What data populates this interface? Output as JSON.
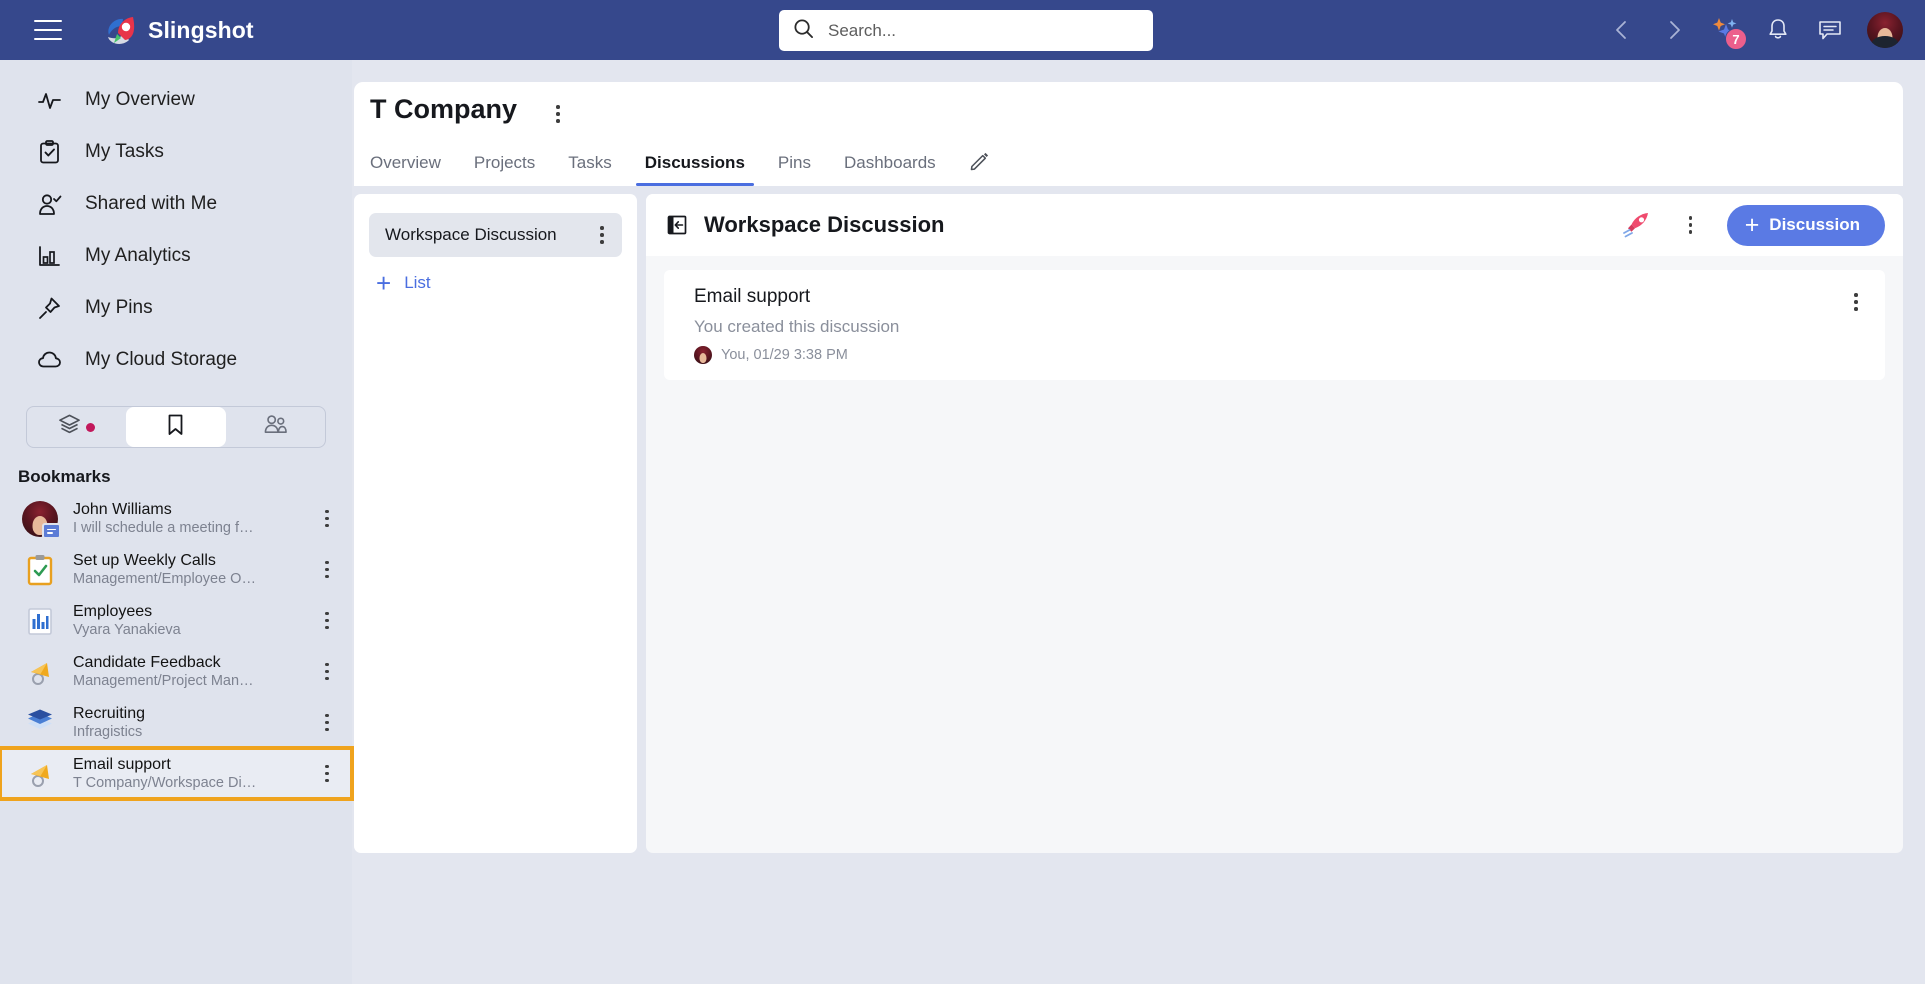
{
  "app": {
    "brand_name": "Slingshot",
    "colors": {
      "header_navy": "#36488c",
      "sidebar_bg": "#dfe3ed",
      "accent_blue": "#4a6ee0",
      "button_blue": "#5a7ae4",
      "highlight_orange": "#efa31d",
      "badge_pink": "#ec5f8c",
      "dot_magenta": "#c2185b"
    }
  },
  "topbar": {
    "menu_icon": "hamburger-icon",
    "logo_icon": "slingshot-logo-icon",
    "search": {
      "placeholder": "Search...",
      "value": "",
      "icon": "search-icon"
    },
    "back_icon": "chevron-left-icon",
    "forward_icon": "chevron-right-icon",
    "sparkle_icon": "sparkles-icon",
    "sparkle_badge": "7",
    "bell_icon": "bell-icon",
    "chat_icon": "chat-icon",
    "avatar": "user-avatar"
  },
  "sidebar": {
    "nav_items": [
      {
        "label": "My Overview",
        "icon": "activity-pulse-icon"
      },
      {
        "label": "My Tasks",
        "icon": "clipboard-check-icon"
      },
      {
        "label": "Shared with Me",
        "icon": "person-check-icon"
      },
      {
        "label": "My Analytics",
        "icon": "bar-chart-icon"
      },
      {
        "label": "My Pins",
        "icon": "pin-icon"
      },
      {
        "label": "My Cloud Storage",
        "icon": "cloud-icon"
      }
    ],
    "tab_switch": [
      {
        "icon": "layers-icon",
        "active": false,
        "has_dot": true
      },
      {
        "icon": "bookmark-icon",
        "active": true,
        "has_dot": false
      },
      {
        "icon": "people-icon",
        "active": false,
        "has_dot": false
      }
    ],
    "bookmarks_title": "Bookmarks",
    "bookmarks": [
      {
        "name": "John Williams",
        "sub": "I will schedule a meeting f…",
        "icon": "avatar-chat-icon",
        "selected": false
      },
      {
        "name": "Set up Weekly Calls",
        "sub": "Management/Employee O…",
        "icon": "clipboard-task-icon",
        "selected": false
      },
      {
        "name": "Employees",
        "sub": "Vyara Yanakieva",
        "icon": "chart-document-icon",
        "selected": false
      },
      {
        "name": "Candidate Feedback",
        "sub": "Management/Project Man…",
        "icon": "megaphone-icon",
        "selected": false
      },
      {
        "name": "Recruiting",
        "sub": "Infragistics",
        "icon": "layers-stack-icon",
        "selected": false
      },
      {
        "name": "Email support",
        "sub": "T Company/Workspace Di…",
        "icon": "megaphone-icon",
        "selected": true
      }
    ]
  },
  "main": {
    "page_title": "T Company",
    "title_menu_icon": "kebab-menu-icon",
    "tabs": [
      {
        "label": "Overview",
        "active": false
      },
      {
        "label": "Projects",
        "active": false
      },
      {
        "label": "Tasks",
        "active": false
      },
      {
        "label": "Discussions",
        "active": true
      },
      {
        "label": "Pins",
        "active": false
      },
      {
        "label": "Dashboards",
        "active": false
      }
    ],
    "tab_edit_icon": "pencil-edit-icon",
    "list_panel": {
      "items": [
        {
          "name": "Workspace Discussion",
          "menu_icon": "kebab-menu-icon",
          "selected": true
        }
      ],
      "add_label": "List",
      "add_icon": "plus-icon"
    },
    "discussion_panel": {
      "collapse_icon": "collapse-panel-icon",
      "title": "Workspace Discussion",
      "rocket_icon": "rocket-icon",
      "menu_icon": "kebab-menu-icon",
      "new_button_label": "Discussion",
      "new_button_icon": "plus-icon",
      "discussions": [
        {
          "title": "Email support",
          "subtitle": "You created this discussion",
          "meta": "You, 01/29 3:38 PM",
          "avatar": "user-avatar",
          "menu_icon": "kebab-menu-icon"
        }
      ]
    }
  }
}
